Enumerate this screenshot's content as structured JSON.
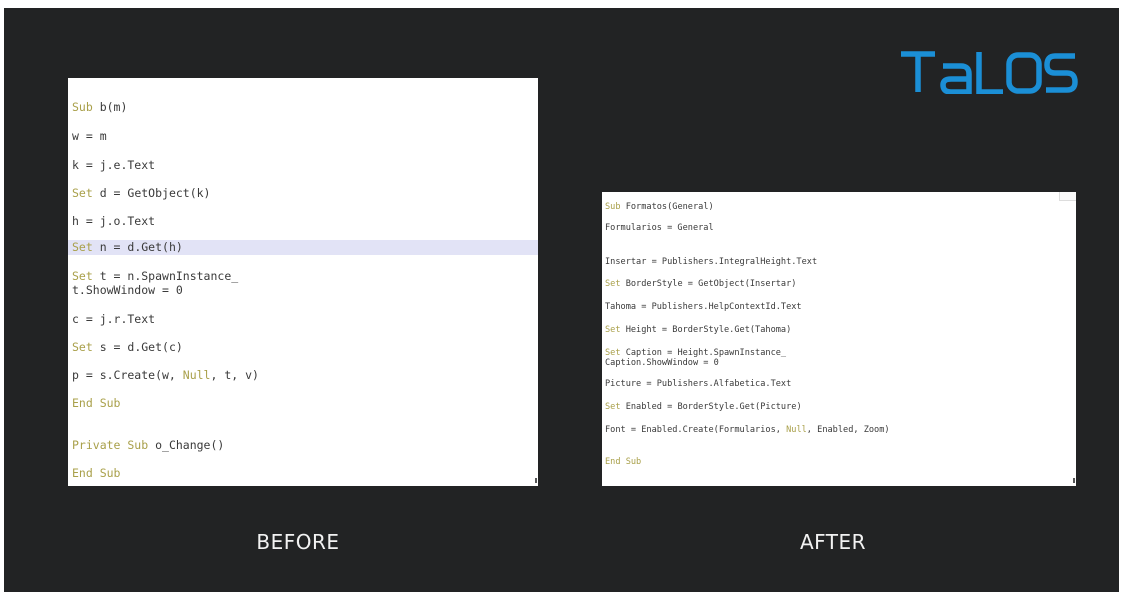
{
  "brand": {
    "logo_text": "TALOS",
    "color": "#1b8fd6"
  },
  "colors": {
    "background": "#222324",
    "keyword": "#a9a04a",
    "code_text": "#3a3a3a",
    "highlight": "#e2e3f6"
  },
  "before": {
    "caption": "BEFORE",
    "lines": [
      {
        "kw": "Sub",
        "rest": " b(m)"
      },
      {
        "kw": "",
        "rest": "w = m"
      },
      {
        "kw": "",
        "rest": "k = j.e.Text"
      },
      {
        "kw": "Set",
        "rest": " d = GetObject(k)"
      },
      {
        "kw": "",
        "rest": "h = j.o.Text"
      },
      {
        "kw": "Set",
        "rest": " n = d.Get(h)"
      },
      {
        "kw": "Set",
        "rest": " t = n.SpawnInstance_"
      },
      {
        "kw": "",
        "rest": "t.ShowWindow = 0"
      },
      {
        "kw": "",
        "rest": "c = j.r.Text"
      },
      {
        "kw": "Set",
        "rest": " s = d.Get(c)"
      },
      {
        "kw": "",
        "rest": "p = s.Create(w, ",
        "kw2": "Null",
        "rest2": ", t, v)"
      },
      {
        "kw": "End Sub",
        "rest": ""
      },
      {
        "kw": "Private Sub",
        "rest": " o_Change()"
      },
      {
        "kw": "End Sub",
        "rest": ""
      }
    ]
  },
  "after": {
    "caption": "AFTER",
    "lines": [
      {
        "kw": "Sub",
        "rest": " Formatos(General)"
      },
      {
        "kw": "",
        "rest": "Formularios = General"
      },
      {
        "kw": "",
        "rest": "Insertar = Publishers.IntegralHeight.Text"
      },
      {
        "kw": "Set",
        "rest": " BorderStyle = GetObject(Insertar)"
      },
      {
        "kw": "",
        "rest": "Tahoma = Publishers.HelpContextId.Text"
      },
      {
        "kw": "Set",
        "rest": " Height = BorderStyle.Get(Tahoma)"
      },
      {
        "kw": "Set",
        "rest": " Caption = Height.SpawnInstance_"
      },
      {
        "kw": "",
        "rest": "Caption.ShowWindow = 0"
      },
      {
        "kw": "",
        "rest": "Picture = Publishers.Alfabetica.Text"
      },
      {
        "kw": "Set",
        "rest": " Enabled = BorderStyle.Get(Picture)"
      },
      {
        "kw": "",
        "rest": "Font = Enabled.Create(Formularios, ",
        "kw2": "Null",
        "rest2": ", Enabled, Zoom)"
      },
      {
        "kw": "End Sub",
        "rest": ""
      }
    ]
  }
}
